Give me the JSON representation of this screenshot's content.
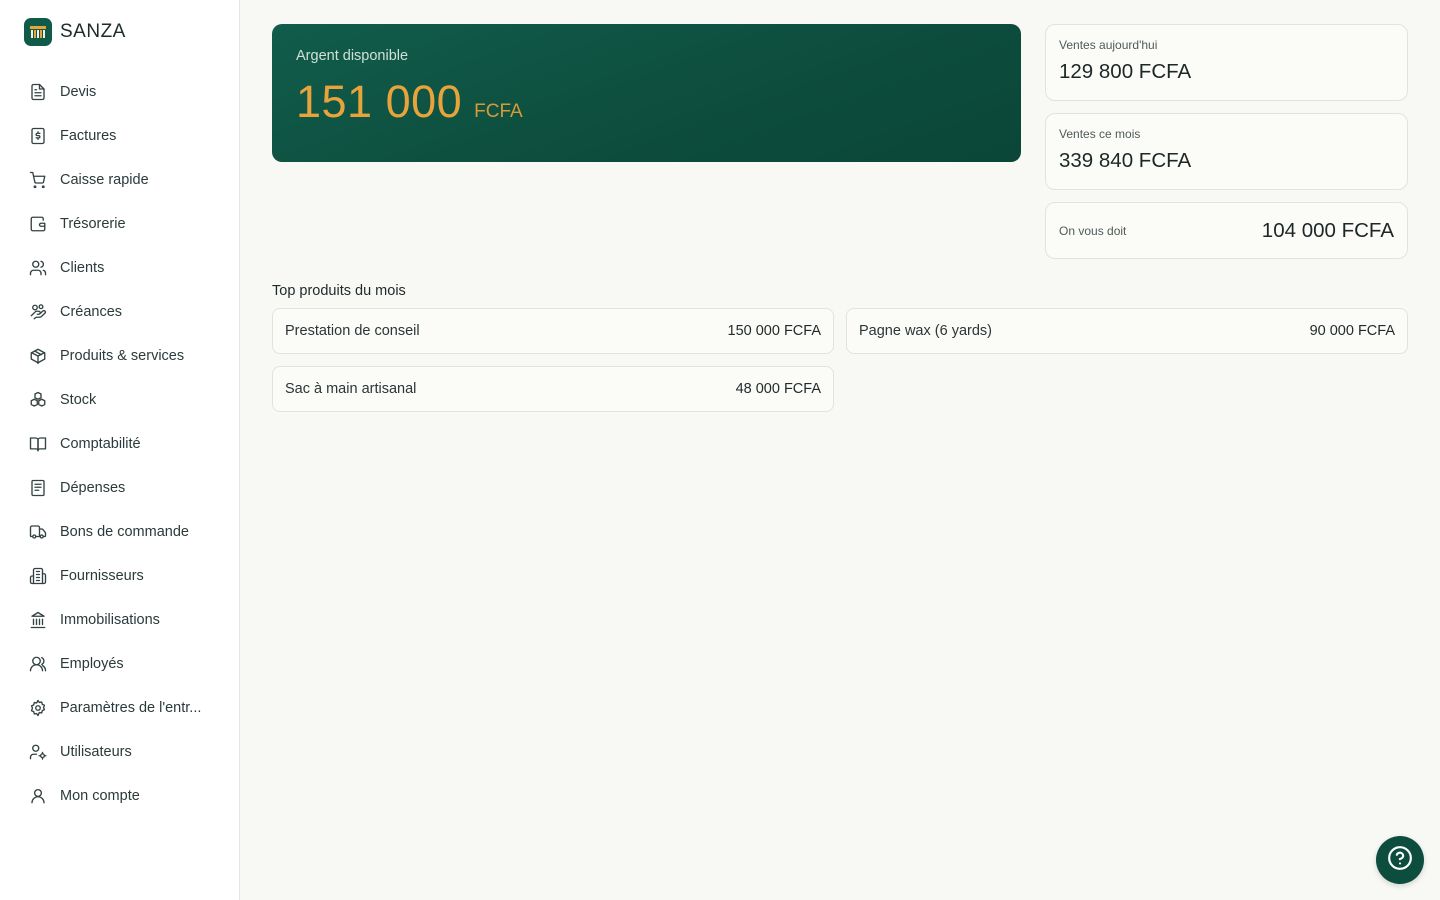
{
  "brand": {
    "name": "SANZA",
    "logo_icon": "sanza-logo-icon",
    "color": "#0f5a48"
  },
  "sidebar": {
    "items": [
      {
        "label": "Devis",
        "icon": "document-icon"
      },
      {
        "label": "Factures",
        "icon": "invoice-dollar-icon"
      },
      {
        "label": "Caisse rapide",
        "icon": "cart-icon"
      },
      {
        "label": "Trésorerie",
        "icon": "wallet-icon"
      },
      {
        "label": "Clients",
        "icon": "users-icon"
      },
      {
        "label": "Créances",
        "icon": "hand-coins-icon"
      },
      {
        "label": "Produits & services",
        "icon": "package-icon"
      },
      {
        "label": "Stock",
        "icon": "boxes-icon"
      },
      {
        "label": "Comptabilité",
        "icon": "book-open-icon"
      },
      {
        "label": "Dépenses",
        "icon": "receipt-icon"
      },
      {
        "label": "Bons de commande",
        "icon": "truck-icon"
      },
      {
        "label": "Fournisseurs",
        "icon": "building-icon"
      },
      {
        "label": "Immobilisations",
        "icon": "landmark-icon"
      },
      {
        "label": "Employés",
        "icon": "user-group-icon"
      },
      {
        "label": "Paramètres de l'entr...",
        "icon": "gear-icon"
      },
      {
        "label": "Utilisateurs",
        "icon": "user-cog-icon"
      },
      {
        "label": "Mon compte",
        "icon": "user-icon"
      }
    ]
  },
  "balance": {
    "label": "Argent disponible",
    "amount": "151 000",
    "currency": "FCFA",
    "accent": "#e8a43b"
  },
  "stats": {
    "today": {
      "label": "Ventes aujourd'hui",
      "value": "129 800 FCFA"
    },
    "month": {
      "label": "Ventes ce mois",
      "value": "339 840 FCFA"
    },
    "owed": {
      "label": "On vous doit",
      "value": "104 000 FCFA"
    }
  },
  "top_products": {
    "title": "Top produits du mois",
    "items": [
      {
        "name": "Prestation de conseil",
        "amount": "150 000 FCFA"
      },
      {
        "name": "Pagne wax (6 yards)",
        "amount": "90 000 FCFA"
      },
      {
        "name": "Sac à main artisanal",
        "amount": "48 000 FCFA"
      }
    ]
  },
  "help": {
    "icon": "help-circle-icon"
  }
}
